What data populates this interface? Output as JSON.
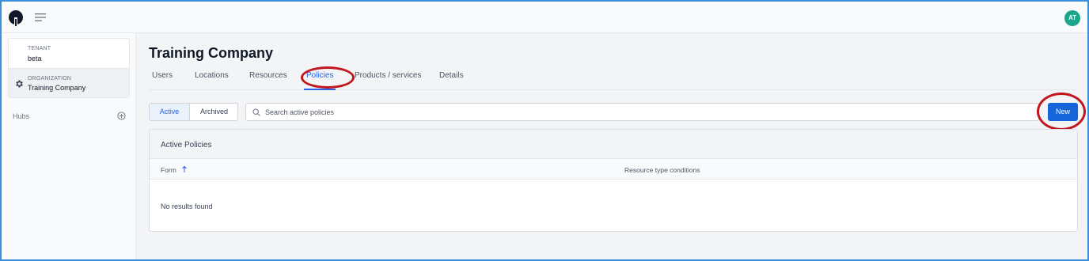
{
  "header": {
    "avatar_initials": "AT",
    "icons": [
      "logo-icon",
      "menu-icon"
    ]
  },
  "sidebar": {
    "tenant_label": "TENANT",
    "tenant_value": "beta",
    "org_label": "ORGANIZATION",
    "org_value": "Training Company",
    "hubs_label": "Hubs"
  },
  "main": {
    "title": "Training Company",
    "tabs": [
      {
        "label": "Users"
      },
      {
        "label": "Locations"
      },
      {
        "label": "Resources"
      },
      {
        "label": "Policies"
      },
      {
        "label": "Products / services"
      },
      {
        "label": "Details"
      }
    ],
    "active_tab": "Policies",
    "filter": {
      "active": "Active",
      "archived": "Archived"
    },
    "search": {
      "placeholder": "Search active policies"
    },
    "new_button": "New",
    "panel": {
      "title": "Active Policies",
      "columns": [
        "Form",
        "Resource type conditions"
      ],
      "empty_text": "No results found"
    }
  },
  "colors": {
    "accent": "#2563eb",
    "primary_button": "#1565d8",
    "avatar": "#1aa68a",
    "annotation": "#c0171f"
  }
}
